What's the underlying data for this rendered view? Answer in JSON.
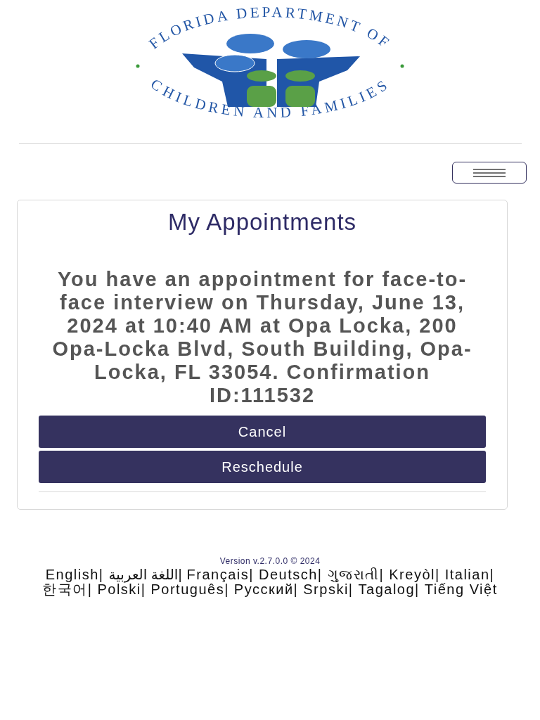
{
  "logo": {
    "top_text": "FLORIDA DEPARTMENT OF",
    "bottom_text": "CHILDREN AND FAMILIES"
  },
  "card": {
    "title": "My Appointments",
    "message": "You have an appointment for face-to-face interview on Thursday, June 13, 2024 at 10:40 AM at Opa Locka, 200 Opa-Locka Blvd, South Building, Opa-Locka, FL 33054. Confirmation ID:111532",
    "buttons": [
      "Cancel",
      "Reschedule"
    ]
  },
  "footer": {
    "version": "Version v.2.7.0.0 © 2024",
    "languages": [
      "English|",
      "اللغة العربية|",
      "Français|",
      "Deutsch|",
      "ગુજરાતી|",
      "Kreyòl|",
      "Italian|",
      "한국어|",
      "Polski|",
      "Português|",
      "Русский|",
      "Srpski|",
      "Tagalog|",
      "Tiếng Việt"
    ]
  }
}
